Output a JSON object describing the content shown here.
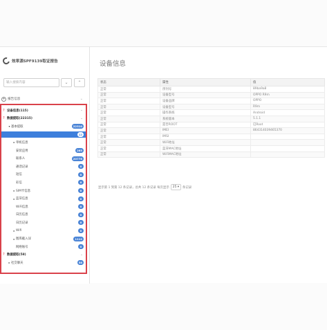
{
  "brand": {
    "title": "效率源SPF9139取证报告"
  },
  "search": {
    "placeholder": "输入搜索内容",
    "btn_clear": "⌄",
    "btn_up": "⌃"
  },
  "report_item": {
    "label": "报告信息"
  },
  "tree": [
    {
      "label": "设备信息(115)",
      "kind": "sec"
    },
    {
      "label": "数据提取(22315)",
      "kind": "sec"
    },
    {
      "label": "基本提取",
      "indent": 1,
      "tri": "down",
      "badge": "22310"
    },
    {
      "label": "",
      "indent": 2,
      "selected": true,
      "badge": "12"
    },
    {
      "label": "单机信息",
      "indent": 2,
      "tri": "right",
      "badge": ""
    },
    {
      "label": "安装应用",
      "indent": 2,
      "badge": "265"
    },
    {
      "label": "联系人",
      "indent": 2,
      "badge": "20776"
    },
    {
      "label": "通话记录",
      "indent": 2,
      "badge": "0"
    },
    {
      "label": "短信",
      "indent": 2,
      "badge": "0"
    },
    {
      "label": "彩信",
      "indent": 2,
      "badge": "0"
    },
    {
      "label": "SIM卡信息",
      "indent": 2,
      "tri": "right",
      "badge": "0"
    },
    {
      "label": "蓝牙信息",
      "indent": 2,
      "tri": "right",
      "badge": "0"
    },
    {
      "label": "WiFi信息",
      "indent": 2,
      "badge": "0"
    },
    {
      "label": "日历信息",
      "indent": 2,
      "badge": "0"
    },
    {
      "label": "日历记录",
      "indent": 2,
      "badge": "0"
    },
    {
      "label": "Wifi",
      "indent": 2,
      "tri": "right",
      "badge": "0"
    },
    {
      "label": "图库截入详",
      "indent": 2,
      "tri": "right",
      "badge": "1112"
    },
    {
      "label": "网络账号",
      "indent": 2,
      "badge": "0"
    },
    {
      "label": "数据提取(58)",
      "kind": "sec"
    },
    {
      "label": "社交聊天",
      "indent": 1,
      "tri": "right",
      "badge": "58"
    }
  ],
  "main": {
    "title": "设备信息"
  },
  "table": {
    "headers": [
      "状态",
      "属性",
      "值"
    ],
    "rows": [
      [
        "正常",
        "序列号",
        "89ba9a8"
      ],
      [
        "正常",
        "设备型号",
        "OPPO R9m"
      ],
      [
        "正常",
        "设备品牌",
        "OPPO"
      ],
      [
        "正常",
        "设备型号",
        "R9m"
      ],
      [
        "正常",
        "操作系统",
        "Android"
      ],
      [
        "正常",
        "系统版本",
        "5.1.1"
      ],
      [
        "正常",
        "是否ROOT",
        "已Root"
      ],
      [
        "正常",
        "IMEI",
        "864314039465370"
      ],
      [
        "正常",
        "IMSI",
        ""
      ],
      [
        "正常",
        "WiFi地址",
        ""
      ],
      [
        "正常",
        "蓝牙MAC地址",
        ""
      ],
      [
        "正常",
        "WiFiMAC地址",
        ""
      ]
    ]
  },
  "pager": {
    "summary": "显示第 1 到第 12 条记录，总共 12 条记录 每页显示",
    "page_size": "25 ▾",
    "suffix": "条记录"
  }
}
